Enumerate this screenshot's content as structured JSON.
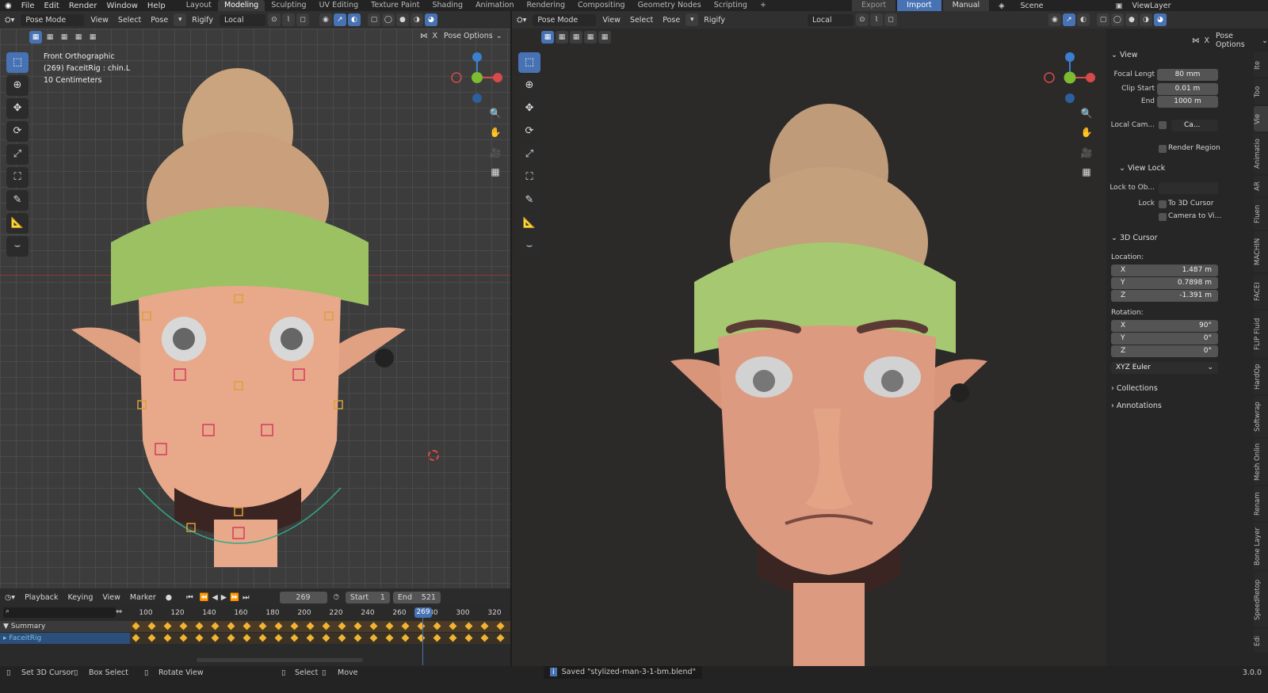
{
  "topbar": {
    "menus": [
      "File",
      "Edit",
      "Render",
      "Window",
      "Help"
    ],
    "workspaces": [
      "Layout",
      "Modeling",
      "Sculpting",
      "UV Editing",
      "Texture Paint",
      "Shading",
      "Animation",
      "Rendering",
      "Compositing",
      "Geometry Nodes",
      "Scripting"
    ],
    "active_workspace": "Modeling",
    "add_tab": "+",
    "export_label": "Export",
    "import_label": "Import",
    "manual_label": "Manual",
    "scene": "Scene",
    "view_layer": "ViewLayer"
  },
  "left_viewport": {
    "mode": "Pose Mode",
    "menus": [
      "View",
      "Select",
      "Pose"
    ],
    "rigify": "Rigify",
    "orientation": "Local",
    "pose_options": "Pose Options",
    "overlay_lines": [
      "Front Orthographic",
      "(269) FaceitRig : chin.L",
      "10 Centimeters"
    ]
  },
  "right_viewport": {
    "mode": "Pose Mode",
    "menus": [
      "View",
      "Select",
      "Pose"
    ],
    "rigify": "Rigify",
    "orientation": "Local",
    "pose_options": "Pose Options"
  },
  "gizmo": {
    "x": "X",
    "y": "Y",
    "z": "Z",
    "color_x": "#d64a4a",
    "color_y": "#7cbd2f",
    "color_z": "#3a7fd0"
  },
  "sidebar": {
    "view_section": "View",
    "focal_label": "Focal Lengt",
    "focal_value": "80 mm",
    "clip_start_label": "Clip Start",
    "clip_start_value": "0.01 m",
    "end_label": "End",
    "end_value": "1000 m",
    "local_camera_label": "Local Cam...",
    "local_camera_value": "Ca...",
    "render_region": "Render Region",
    "view_lock_section": "View Lock",
    "lock_to_object_label": "Lock to Ob...",
    "lock_label": "Lock",
    "lock_to_cursor": "To 3D Cursor",
    "camera_to_view": "Camera to Vi...",
    "cursor_section": "3D Cursor",
    "location_label": "Location:",
    "loc_x_label": "X",
    "loc_x": "1.487 m",
    "loc_y_label": "Y",
    "loc_y": "0.7898 m",
    "loc_z_label": "Z",
    "loc_z": "-1.391 m",
    "rotation_label": "Rotation:",
    "rot_x_label": "X",
    "rot_x": "90°",
    "rot_y_label": "Y",
    "rot_y": "0°",
    "rot_z_label": "Z",
    "rot_z": "0°",
    "rotation_mode": "XYZ Euler",
    "collections": "Collections",
    "annotations": "Annotations",
    "tabs": [
      "Ite",
      "Too",
      "Vie",
      "Animatio",
      "AR",
      "Fluen",
      "MACHIN",
      "FACEI",
      "FLIP Fluid",
      "HardOp",
      "Softwrap",
      "Mesh Onlin",
      "Renam",
      "Bone Layer",
      "SpeedRetop",
      "Edi"
    ]
  },
  "timeline": {
    "menus": [
      "Playback",
      "Keying",
      "View",
      "Marker"
    ],
    "current_frame": "269",
    "start_label": "Start",
    "start_value": "1",
    "end_label": "End",
    "end_value": "521",
    "ruler": [
      "100",
      "120",
      "140",
      "160",
      "180",
      "200",
      "220",
      "240",
      "260",
      "280",
      "300",
      "320"
    ],
    "playhead": "269",
    "channels": [
      "Summary",
      "FaceitRig"
    ]
  },
  "status": {
    "hint1": "Set 3D Cursor",
    "hint2": "Box Select",
    "hint3": "Rotate View",
    "hint4": "Select",
    "hint5": "Move",
    "message": "Saved \"stylized-man-3-1-bm.blend\"",
    "version": "3.0.0"
  }
}
